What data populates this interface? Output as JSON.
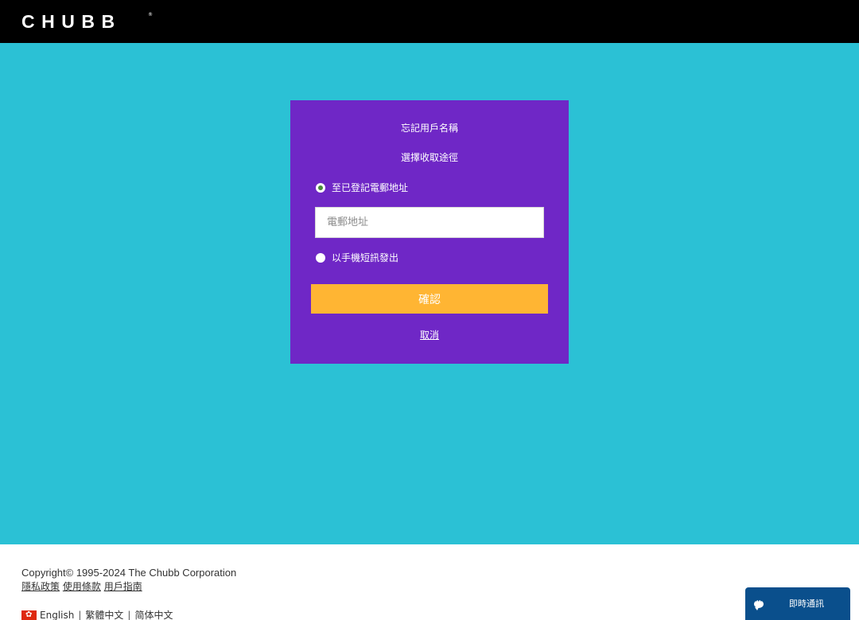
{
  "header": {
    "logo_text": "CHUBB",
    "logo_mark": "®"
  },
  "card": {
    "title": "忘記用戶名稱",
    "subtitle": "選擇收取途徑",
    "options": [
      {
        "label": "至已登記電郵地址",
        "selected": true
      },
      {
        "label": "以手機短訊發出",
        "selected": false
      }
    ],
    "email_input": {
      "placeholder": "電郵地址",
      "value": ""
    },
    "confirm_label": "確認",
    "cancel_label": "取消"
  },
  "footer": {
    "copyright": "Copyright© 1995-2024 The Chubb Corporation",
    "links": [
      "隱私政策",
      "使用條款",
      "用戶指南"
    ],
    "languages": [
      "English",
      "繁體中文",
      "简体中文"
    ],
    "language_separator": "|"
  },
  "chat": {
    "label": "即時通訊"
  },
  "colors": {
    "header_bg": "#000000",
    "main_bg": "#2bc1d5",
    "card_bg": "#6f27c6",
    "confirm_bg": "#ffb533",
    "chat_bg": "#0a4f8c"
  }
}
